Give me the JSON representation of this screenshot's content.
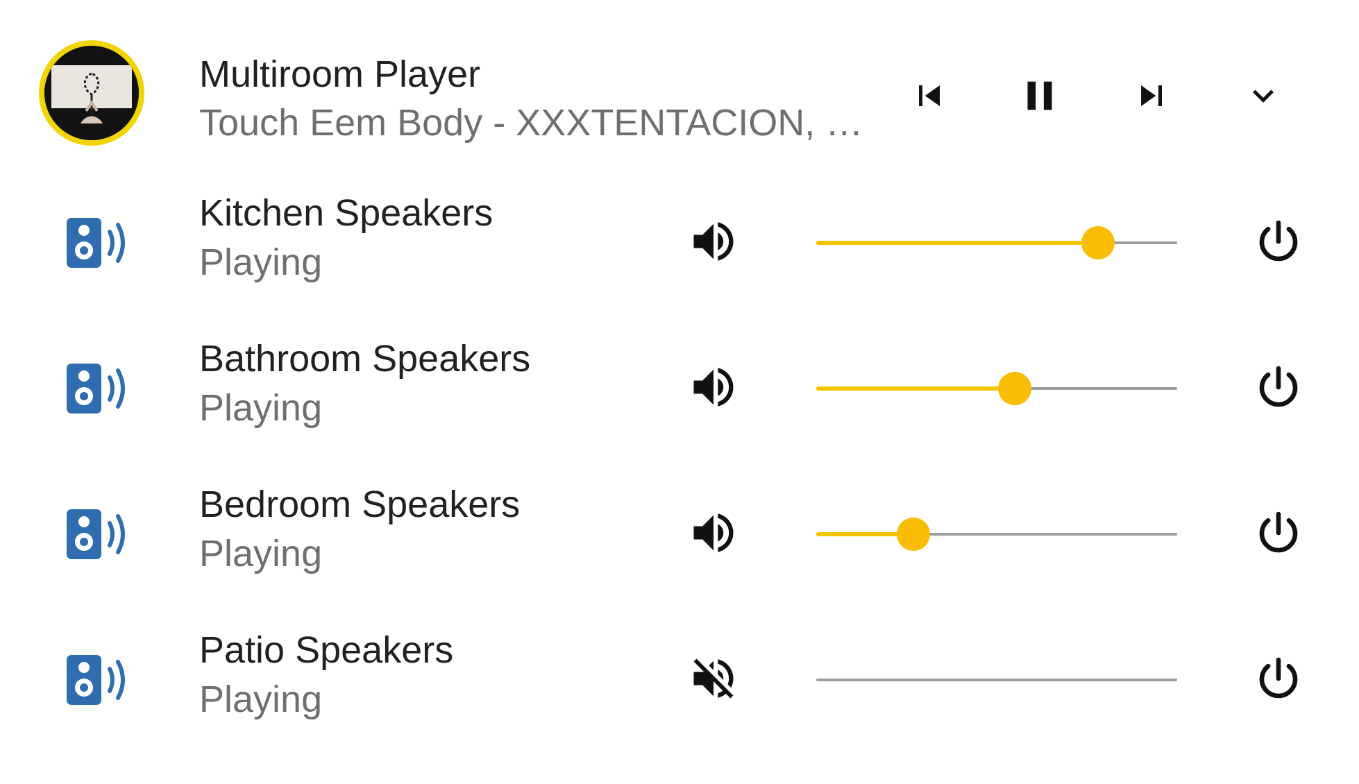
{
  "player": {
    "title": "Multiroom Player",
    "subtitle": "Touch Eem Body - XXXTENTACION, B...",
    "artwork_border_color": "#f2d402",
    "controls": [
      {
        "name": "previous-track",
        "icon": "skip-previous-icon"
      },
      {
        "name": "pause",
        "icon": "pause-icon"
      },
      {
        "name": "next-track",
        "icon": "skip-next-icon"
      },
      {
        "name": "expand",
        "icon": "chevron-down-icon"
      }
    ]
  },
  "colors": {
    "accent": "#fbbc05",
    "speaker_icon": "#2f6db0",
    "track": "#9e9e9e"
  },
  "speakers": [
    {
      "name": "Kitchen Speakers",
      "state": "Playing",
      "muted": false,
      "volume": 0.78
    },
    {
      "name": "Bathroom Speakers",
      "state": "Playing",
      "muted": false,
      "volume": 0.55
    },
    {
      "name": "Bedroom Speakers",
      "state": "Playing",
      "muted": false,
      "volume": 0.27
    },
    {
      "name": "Patio Speakers",
      "state": "Playing",
      "muted": true,
      "volume": 0.0
    }
  ]
}
